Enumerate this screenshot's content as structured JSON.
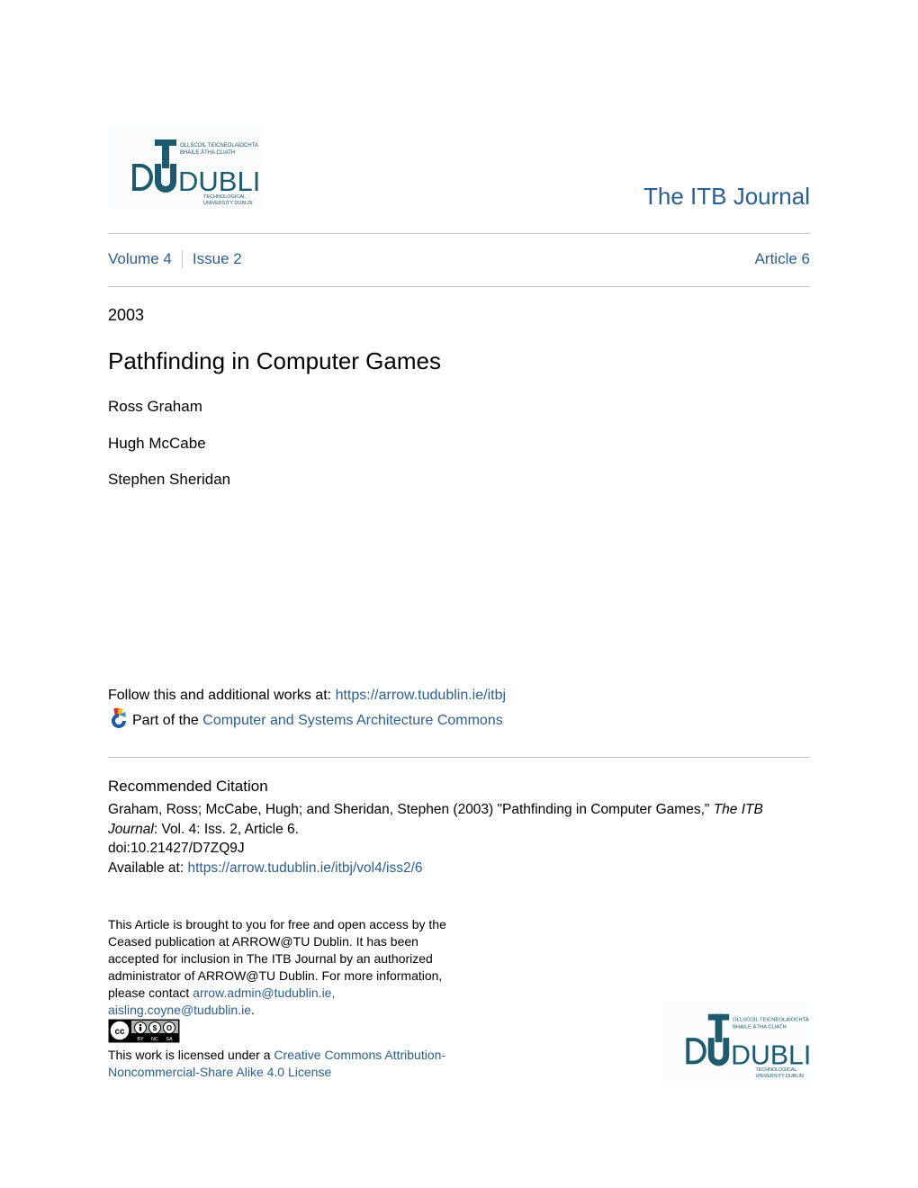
{
  "header": {
    "logo_alt": "TU Dublin logo",
    "logo": {
      "irish_line1": "OLLSCOIL TEICNEOLAÍOCHTA",
      "irish_line2": "BHAILE ÁTHA CLIATH",
      "wordmark": "DUBLIN",
      "english_line1": "TECHNOLOGICAL",
      "english_line2": "UNIVERSITY DUBLIN"
    },
    "journal_title": "The ITB Journal"
  },
  "nav": {
    "volume": "Volume 4",
    "issue": "Issue 2",
    "article": "Article 6"
  },
  "article": {
    "year": "2003",
    "title": "Pathfinding in Computer Games",
    "authors": [
      "Ross Graham",
      "Hugh McCabe",
      "Stephen Sheridan"
    ]
  },
  "follow": {
    "prefix": "Follow this and additional works at: ",
    "url": "https://arrow.tudublin.ie/itbj"
  },
  "part_of": {
    "icon": "bepress-commons-icon",
    "prefix": "Part of the ",
    "link": "Computer and Systems Architecture Commons"
  },
  "citation": {
    "heading": "Recommended Citation",
    "text_prefix": "Graham, Ross; McCabe, Hugh; and Sheridan, Stephen (2003) \"Pathfinding in Computer Games,\" ",
    "journal_italic": "The ITB Journal",
    "text_suffix": ": Vol. 4: Iss. 2, Article 6.",
    "doi": "doi:10.21427/D7ZQ9J",
    "available_prefix": "Available at: ",
    "available_url": "https://arrow.tudublin.ie/itbj/vol4/iss2/6"
  },
  "notice": {
    "text": "This Article is brought to you for free and open access by the Ceased publication at ARROW@TU Dublin. It has been accepted for inclusion in The ITB Journal by an authorized administrator of ARROW@TU Dublin. For more information, please contact ",
    "email1": "arrow.admin@tudublin.ie,",
    "email2": "aisling.coyne@tudublin.ie",
    "end": "."
  },
  "license": {
    "badge_labels": [
      "BY",
      "NC",
      "SA"
    ],
    "badge_cc": "cc",
    "prefix": "This work is licensed under a ",
    "link": "Creative Commons Attribution-Noncommercial-Share Alike 4.0 License"
  },
  "colors": {
    "link": "#2b5e91",
    "logo": "#1d5a6e",
    "rule": "#c4c4c4"
  }
}
